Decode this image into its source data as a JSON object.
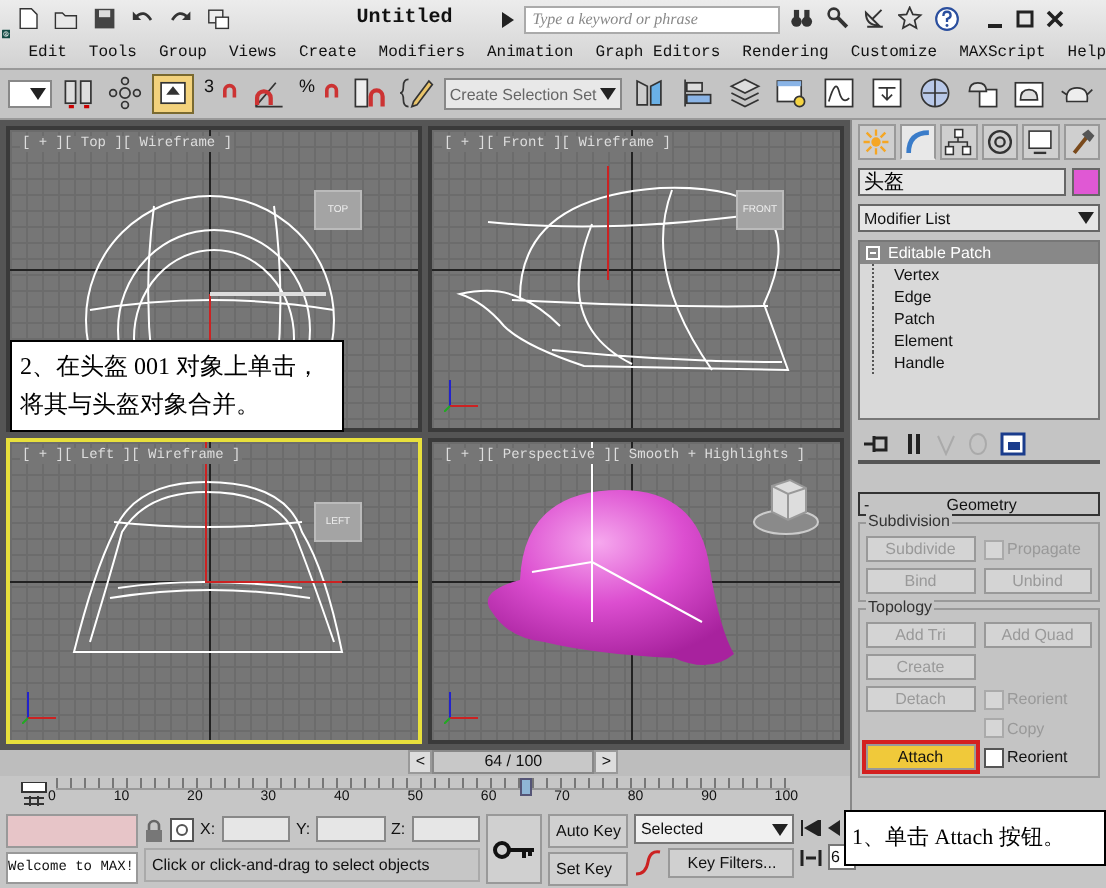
{
  "window": {
    "title": "Untitled",
    "search": {
      "placeholder": "Type a keyword or phrase"
    }
  },
  "quick_access": [
    {
      "kind": "new"
    },
    {
      "kind": "open"
    },
    {
      "kind": "save"
    },
    {
      "kind": "undo"
    },
    {
      "kind": "redo"
    },
    {
      "kind": "project"
    }
  ],
  "info_tools": [
    {
      "kind": "binoculars"
    },
    {
      "kind": "key"
    },
    {
      "kind": "satellite"
    },
    {
      "kind": "star"
    },
    {
      "kind": "help"
    }
  ],
  "menu": [
    "Edit",
    "Tools",
    "Group",
    "Views",
    "Create",
    "Modifiers",
    "Animation",
    "Graph Editors",
    "Rendering",
    "Customize",
    "MAXScript",
    "Help"
  ],
  "toolbar": {
    "left_tools": [
      {
        "kind": "filter",
        "selected": false
      },
      {
        "kind": "link",
        "selected": false
      },
      {
        "kind": "manipulate",
        "selected": false
      },
      {
        "kind": "select",
        "selected": true
      },
      {
        "kind": "snap",
        "label": "3",
        "selected": false
      },
      {
        "kind": "angle-snap",
        "selected": false
      },
      {
        "kind": "percent-snap",
        "label": "%",
        "selected": false
      },
      {
        "kind": "spinner-snap",
        "selected": false
      },
      {
        "kind": "edit-named",
        "selected": false
      }
    ],
    "selection_set": {
      "placeholder": "Create Selection Set"
    },
    "right_tools": [
      {
        "kind": "mirror",
        "selected": false
      },
      {
        "kind": "align",
        "selected": false
      },
      {
        "kind": "layers",
        "selected": false
      },
      {
        "kind": "scene-explorer",
        "selected": false
      },
      {
        "kind": "curve-editor",
        "selected": false
      },
      {
        "kind": "schematic",
        "selected": false
      },
      {
        "kind": "material",
        "selected": false
      },
      {
        "kind": "render-setup",
        "selected": false
      },
      {
        "kind": "render-frame",
        "selected": false
      },
      {
        "kind": "teapot",
        "selected": false
      }
    ]
  },
  "viewports": [
    {
      "kind": "top",
      "label": "[ + ][ Top ][ Wireframe ]",
      "cube_label": "TOP",
      "selected": false
    },
    {
      "kind": "front",
      "label": "[ + ][ Front ][ Wireframe ]",
      "cube_label": "FRONT",
      "selected": false
    },
    {
      "kind": "left",
      "label": "[ + ][ Left ][ Wireframe ]",
      "cube_label": "LEFT",
      "selected": true
    },
    {
      "kind": "perspective",
      "label": "[ + ][ Perspective ][ Smooth + Highlights ]",
      "selected": false
    }
  ],
  "time_slider": {
    "prev": "<",
    "position": "64 / 100",
    "next": ">",
    "level": 0.64
  },
  "ruler": {
    "ticks": [
      "0",
      "10",
      "20",
      "30",
      "40",
      "50",
      "60",
      "70",
      "80",
      "90",
      "100"
    ]
  },
  "command_panel": {
    "tabs": [
      {
        "kind": "create",
        "selected": false
      },
      {
        "kind": "modify",
        "selected": true
      },
      {
        "kind": "hierarchy",
        "selected": false
      },
      {
        "kind": "motion",
        "selected": false
      },
      {
        "kind": "display",
        "selected": false
      },
      {
        "kind": "utilities",
        "selected": false
      }
    ],
    "object_name": "头盔",
    "modifier_list": {
      "placeholder": "Modifier List"
    },
    "stack": [
      {
        "name": "Editable Patch",
        "expanded": true,
        "selected": true,
        "children": [
          {
            "name": "Vertex"
          },
          {
            "name": "Edge"
          },
          {
            "name": "Patch"
          },
          {
            "name": "Element"
          },
          {
            "name": "Handle"
          }
        ]
      }
    ],
    "rollout": {
      "title": "Geometry",
      "toggle": "-",
      "groups": [
        {
          "title": "Subdivision",
          "rows": [
            [
              {
                "kind": "button",
                "label": "Subdivide",
                "disabled": true,
                "highlighted": false
              },
              {
                "kind": "checkbox",
                "label": "Propagate",
                "checked": false,
                "disabled": true
              }
            ],
            [
              {
                "kind": "button",
                "label": "Bind",
                "disabled": true,
                "highlighted": false
              },
              {
                "kind": "button",
                "label": "Unbind",
                "disabled": true,
                "highlighted": false
              }
            ]
          ]
        },
        {
          "title": "Topology",
          "rows": [
            [
              {
                "kind": "button",
                "label": "Add Tri",
                "disabled": true,
                "highlighted": false
              },
              {
                "kind": "button",
                "label": "Add Quad",
                "disabled": true,
                "highlighted": false
              }
            ],
            [
              {
                "kind": "button",
                "label": "Create",
                "disabled": true,
                "highlighted": false
              }
            ],
            [
              {
                "kind": "button",
                "label": "Detach",
                "disabled": true,
                "highlighted": false
              },
              {
                "kind": "checkbox",
                "label": "Reorient",
                "checked": false,
                "disabled": true
              }
            ],
            [
              "",
              {
                "kind": "checkbox",
                "label": "Copy",
                "checked": false,
                "disabled": true
              }
            ],
            [
              {
                "kind": "button",
                "label": "Attach",
                "disabled": false,
                "highlighted": true
              },
              {
                "kind": "checkbox",
                "label": "Reorient",
                "checked": false,
                "disabled": false
              }
            ]
          ]
        }
      ]
    }
  },
  "status_bar": {
    "welcome": "Welcome to MAX!",
    "coords": [
      {
        "axis": "X:"
      },
      {
        "axis": "Y:"
      },
      {
        "axis": "Z:"
      }
    ],
    "prompt": "Click or click-and-drag to select objects",
    "auto_key": "Auto Key",
    "set_key": "Set Key",
    "key_mode": "Selected",
    "key_filters": "Key Filters...",
    "frame": "6"
  },
  "callouts": [
    {
      "kind": "viewport",
      "text": "2、在头盔 001 对象上单击，将其与头盔对象合并。"
    },
    {
      "kind": "panel",
      "text": "1、单击 Attach 按钮。"
    }
  ]
}
